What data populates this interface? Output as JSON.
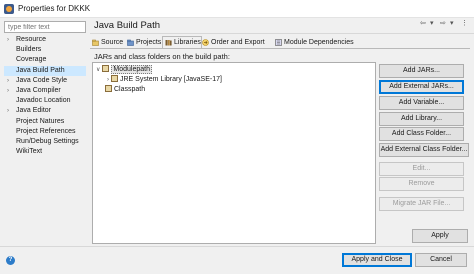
{
  "window": {
    "title": "Properties for DKKK"
  },
  "filter": {
    "placeholder": "type filter text"
  },
  "nav_tree": [
    {
      "label": "Resource",
      "expandable": true
    },
    {
      "label": "Builders"
    },
    {
      "label": "Coverage"
    },
    {
      "label": "Java Build Path",
      "selected": true
    },
    {
      "label": "Java Code Style",
      "expandable": true
    },
    {
      "label": "Java Compiler",
      "expandable": true
    },
    {
      "label": "Javadoc Location"
    },
    {
      "label": "Java Editor",
      "expandable": true
    },
    {
      "label": "Project Natures"
    },
    {
      "label": "Project References"
    },
    {
      "label": "Run/Debug Settings"
    },
    {
      "label": "WikiText"
    }
  ],
  "page": {
    "title": "Java Build Path",
    "section_label": "JARs and class folders on the build path:"
  },
  "tabs": [
    {
      "label": "Source",
      "icon": "source-folder-icon"
    },
    {
      "label": "Projects",
      "icon": "projects-icon"
    },
    {
      "label": "Libraries",
      "icon": "libraries-icon",
      "active": true
    },
    {
      "label": "Order and Export",
      "icon": "order-export-icon"
    },
    {
      "label": "Module Dependencies",
      "icon": "module-deps-icon"
    }
  ],
  "classpath_tree": {
    "modulepath": "Modulepath",
    "jre": "JRE System Library [JavaSE-17]",
    "classpath": "Classpath"
  },
  "side_buttons": [
    {
      "label": "Add JARs...",
      "enabled": true
    },
    {
      "label": "Add External JARs...",
      "enabled": true,
      "default": true
    },
    {
      "label": "Add Variable...",
      "enabled": true
    },
    {
      "label": "Add Library...",
      "enabled": true
    },
    {
      "label": "Add Class Folder...",
      "enabled": true
    },
    {
      "label": "Add External Class Folder...",
      "enabled": true
    },
    {
      "label": "Edit...",
      "enabled": false
    },
    {
      "label": "Remove",
      "enabled": false
    },
    {
      "label": "Migrate JAR File...",
      "enabled": false
    }
  ],
  "footer": {
    "apply": "Apply",
    "apply_and_close": "Apply and Close",
    "cancel": "Cancel"
  }
}
